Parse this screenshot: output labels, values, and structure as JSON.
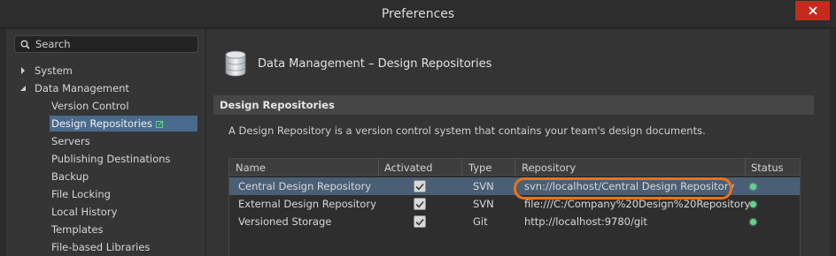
{
  "window": {
    "title": "Preferences",
    "close_icon": "close-icon",
    "close_button_color": "#c42b1c"
  },
  "search": {
    "placeholder": "Search",
    "icon": "search-icon"
  },
  "tree": {
    "items": [
      {
        "label": "System",
        "expanded": false
      },
      {
        "label": "Data Management",
        "expanded": true
      },
      {
        "label": "Version Control"
      },
      {
        "label": "Design Repositories",
        "selected": true,
        "icon": "edit-icon"
      },
      {
        "label": "Servers"
      },
      {
        "label": "Publishing Destinations"
      },
      {
        "label": "Backup"
      },
      {
        "label": "File Locking"
      },
      {
        "label": "Local History"
      },
      {
        "label": "Templates"
      },
      {
        "label": "File-based Libraries"
      }
    ]
  },
  "page": {
    "title": "Data Management – Design Repositories",
    "icon": "database-icon",
    "section_title": "Design Repositories",
    "description": "A Design Repository is a version control system that contains your team's design documents."
  },
  "grid": {
    "columns": [
      "Name",
      "Activated",
      "Type",
      "Repository",
      "Status"
    ],
    "rows": [
      {
        "name": "Central Design Repository",
        "activated": true,
        "type": "SVN",
        "repository": "svn://localhost/Central Design Repository",
        "status": "ok"
      },
      {
        "name": "External Design Repository",
        "activated": true,
        "type": "SVN",
        "repository": "file:///C:/Company%20Design%20Repository",
        "status": "ok"
      },
      {
        "name": "Versioned Storage",
        "activated": true,
        "type": "Git",
        "repository": "http://localhost:9780/git",
        "status": "ok"
      }
    ]
  },
  "colors": {
    "selection": "#4a6a8c",
    "highlight_ring": "#e8741c",
    "status_ok": "#5fd38a"
  }
}
